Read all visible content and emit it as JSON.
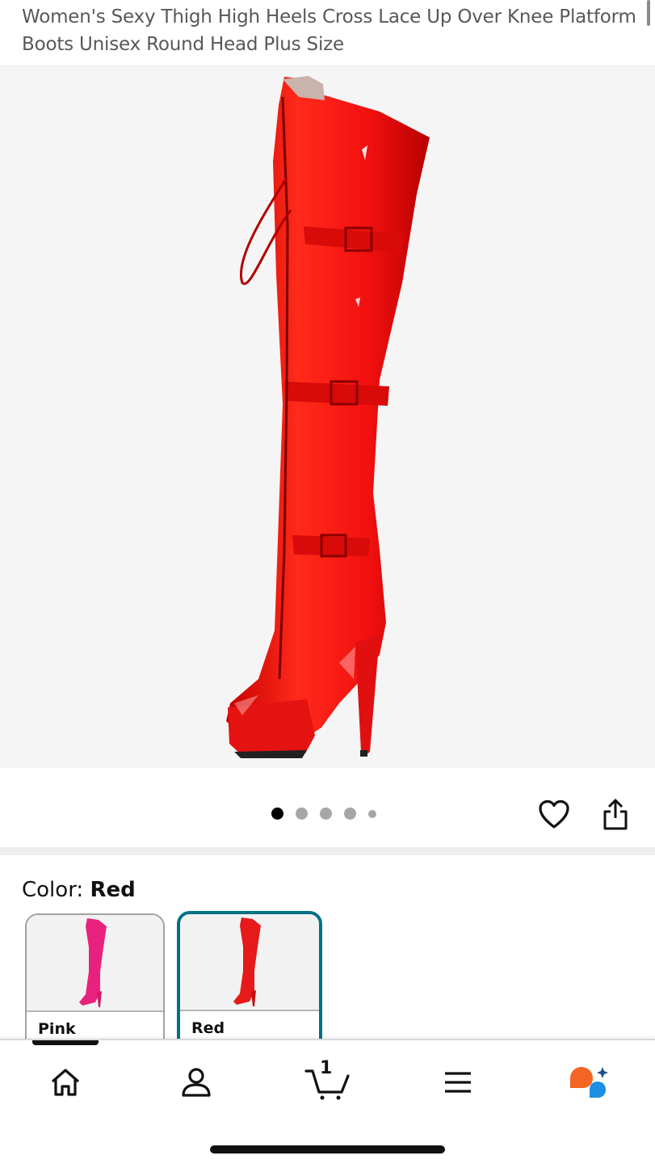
{
  "product": {
    "title": "Women's Sexy Thigh High Heels Cross Lace Up Over Knee Platform Boots Unisex Round Head Plus Size",
    "image": {
      "subject": "red patent thigh-high lace-up platform boot",
      "color": "#ee1c1c"
    }
  },
  "carousel": {
    "total_dots": 5,
    "active_index": 0
  },
  "actions": {
    "wishlist_icon": "heart-icon",
    "share_icon": "share-icon"
  },
  "color_selector": {
    "label": "Color: ",
    "selected": "Red",
    "options": [
      {
        "name": "Pink",
        "swatch": "#e8227c",
        "selected": false
      },
      {
        "name": "Red",
        "swatch": "#e61a1a",
        "selected": true
      }
    ]
  },
  "bottom_nav": {
    "items": [
      {
        "icon": "home-icon",
        "active": true
      },
      {
        "icon": "account-icon",
        "active": false
      },
      {
        "icon": "cart-icon",
        "active": false,
        "count": "1"
      },
      {
        "icon": "menu-icon",
        "active": false
      },
      {
        "icon": "assistant-icon",
        "active": false
      }
    ]
  },
  "colors": {
    "accent": "#007185",
    "title_text": "#565959",
    "hero_bg": "#f5f5f5"
  }
}
